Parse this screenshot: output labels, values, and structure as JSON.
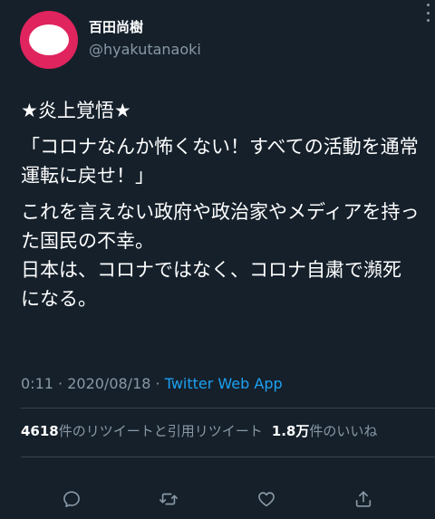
{
  "user": {
    "display_name": "百田尚樹",
    "handle": "@hyakutanaoki"
  },
  "tweet": {
    "line1": "★炎上覚悟★",
    "line2": "「コロナなんか怖くない！すべての活動を通常運転に戻せ！」",
    "line3": "これを言えない政府や政治家やメディアを持った国民の不幸。\n日本は、コロナではなく、コロナ自粛で瀕死になる。",
    "time": "0:11",
    "separator1": " · ",
    "date": "2020/08/18",
    "separator2": " · ",
    "source": "Twitter Web App"
  },
  "stats": {
    "retweets_count": "4618",
    "retweets_label": "件のリツイートと引用リツイート",
    "likes_count": "1.8万",
    "likes_label": "件のいいね"
  },
  "actions": {
    "reply_icon": "reply-icon",
    "retweet_icon": "retweet-icon",
    "like_icon": "heart-icon",
    "share_icon": "share-icon"
  },
  "colors": {
    "background": "#15202b",
    "text_primary": "#ffffff",
    "text_secondary": "#8899a6",
    "link": "#1da1f2",
    "avatar": "#e0245e",
    "divider": "#38444d"
  }
}
